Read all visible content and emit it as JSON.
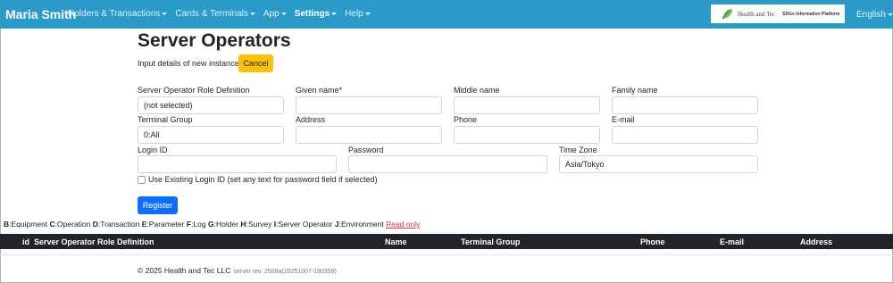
{
  "navbar": {
    "brand": "Maria Smith",
    "menu": [
      {
        "label": "Holders & Transactions",
        "active": false
      },
      {
        "label": "Cards & Terminals",
        "active": false
      },
      {
        "label": "App",
        "active": false
      },
      {
        "label": "Settings",
        "active": true
      },
      {
        "label": "Help",
        "active": false
      }
    ],
    "logo": {
      "name": "Health and Tec",
      "tagline": "SDGs Information Platform"
    },
    "language": "English"
  },
  "page": {
    "title": "Server Operators",
    "intro": "Input details of new instance.",
    "cancel_label": "Cancel"
  },
  "form": {
    "role": {
      "label": "Server Operator Role Definition",
      "value": "(not selected)"
    },
    "given_name": {
      "label": "Given name*",
      "value": ""
    },
    "middle_name": {
      "label": "Middle name",
      "value": ""
    },
    "family_name": {
      "label": "Family name",
      "value": ""
    },
    "terminal_group": {
      "label": "Terminal Group",
      "value": "0:All"
    },
    "address": {
      "label": "Address",
      "value": ""
    },
    "phone": {
      "label": "Phone",
      "value": ""
    },
    "email": {
      "label": "E-mail",
      "value": ""
    },
    "login_id": {
      "label": "Login ID",
      "value": ""
    },
    "password": {
      "label": "Password",
      "value": ""
    },
    "time_zone": {
      "label": "Time Zone",
      "value": "Asia/Tokyo"
    },
    "use_existing_label": "Use Existing Login ID (set any text for password field if selected)",
    "register_label": "Register"
  },
  "legend": {
    "items": [
      {
        "key": "B",
        "text": "Equipment"
      },
      {
        "key": "C",
        "text": "Operation"
      },
      {
        "key": "D",
        "text": "Transaction"
      },
      {
        "key": "E",
        "text": "Parameter"
      },
      {
        "key": "F",
        "text": "Log"
      },
      {
        "key": "G",
        "text": "Holder"
      },
      {
        "key": "H",
        "text": "Survey"
      },
      {
        "key": "I",
        "text": "Server Operator"
      },
      {
        "key": "J",
        "text": "Environment"
      }
    ],
    "read_only": "Read only"
  },
  "table": {
    "columns": [
      "id",
      "Server Operator Role Definition",
      "Name",
      "Terminal Group",
      "Phone",
      "E-mail",
      "Address"
    ]
  },
  "footer": {
    "copyright": "© 2025 Health and Tec LLC",
    "revision": "server rev. 2509a(20251007-190359)"
  },
  "colors": {
    "navbar": "#2a9bc9",
    "cancel": "#ffc107",
    "register": "#0d6efd",
    "table_header": "#212529",
    "read_only_link": "#dc3545"
  }
}
